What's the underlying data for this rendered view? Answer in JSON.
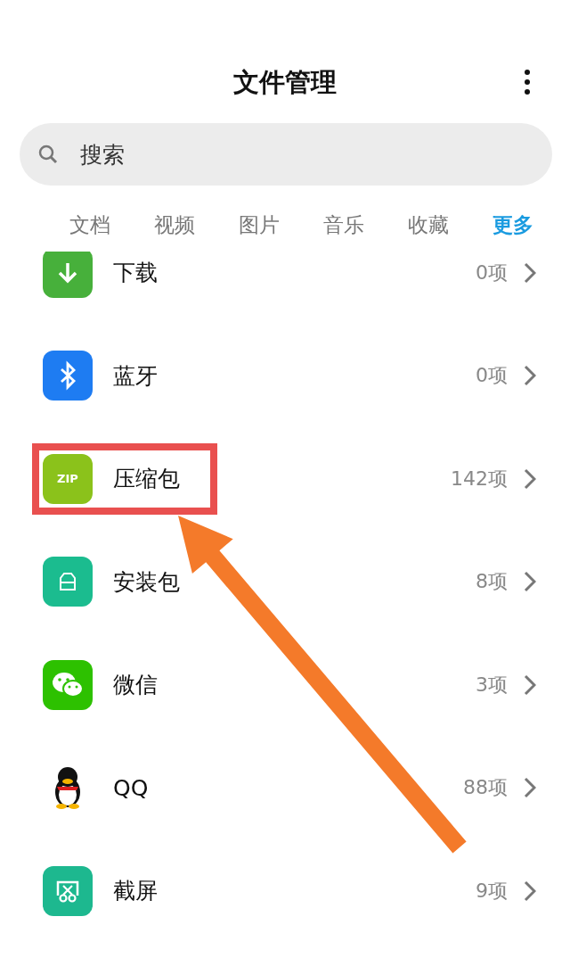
{
  "header": {
    "title": "文件管理"
  },
  "search": {
    "placeholder": "搜索"
  },
  "tabs": [
    {
      "label": "文档",
      "selected": false
    },
    {
      "label": "视频",
      "selected": false
    },
    {
      "label": "图片",
      "selected": false
    },
    {
      "label": "音乐",
      "selected": false
    },
    {
      "label": "收藏",
      "selected": false
    },
    {
      "label": "更多",
      "selected": true
    }
  ],
  "items": [
    {
      "kind": "download",
      "name": "下载",
      "count": "0项",
      "highlighted": false
    },
    {
      "kind": "bluetooth",
      "name": "蓝牙",
      "count": "0项",
      "highlighted": false
    },
    {
      "kind": "zip",
      "badge": "ZIP",
      "name": "压缩包",
      "count": "142项",
      "highlighted": true
    },
    {
      "kind": "install",
      "name": "安装包",
      "count": "8项",
      "highlighted": false
    },
    {
      "kind": "wechat",
      "name": "微信",
      "count": "3项",
      "highlighted": false
    },
    {
      "kind": "qq",
      "name": "QQ",
      "count": "88项",
      "highlighted": false
    },
    {
      "kind": "screenshot",
      "name": "截屏",
      "count": "9项",
      "highlighted": false
    }
  ]
}
